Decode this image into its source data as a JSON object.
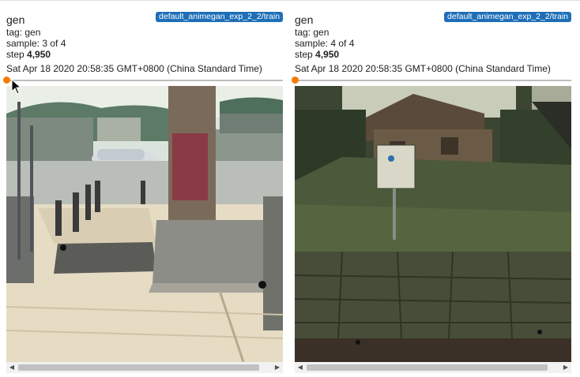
{
  "cards": [
    {
      "run": "default_animegan_exp_2_2/train",
      "title": "gen",
      "tag": "tag: gen",
      "sample": "sample: 3 of 4",
      "step_label": "step",
      "step_value": "4,950",
      "timestamp": "Sat Apr 18 2020 20:58:35 GMT+0800 (China Standard Time)",
      "step_progress": 0.0,
      "image_icon": "generated-street-sidewalk-image"
    },
    {
      "run": "default_animegan_exp_2_2/train",
      "title": "gen",
      "tag": "tag: gen",
      "sample": "sample: 4 of 4",
      "step_label": "step",
      "step_value": "4,950",
      "timestamp": "Sat Apr 18 2020 20:58:35 GMT+0800 (China Standard Time)",
      "step_progress": 0.0,
      "image_icon": "generated-house-stone-wall-image"
    }
  ],
  "colors": {
    "badge": "#1e6fb8",
    "slider_thumb": "#f57c00",
    "slider_track": "#bdbdbd"
  },
  "scrollbar": {
    "left_arrow": "◀",
    "right_arrow": "▶"
  }
}
